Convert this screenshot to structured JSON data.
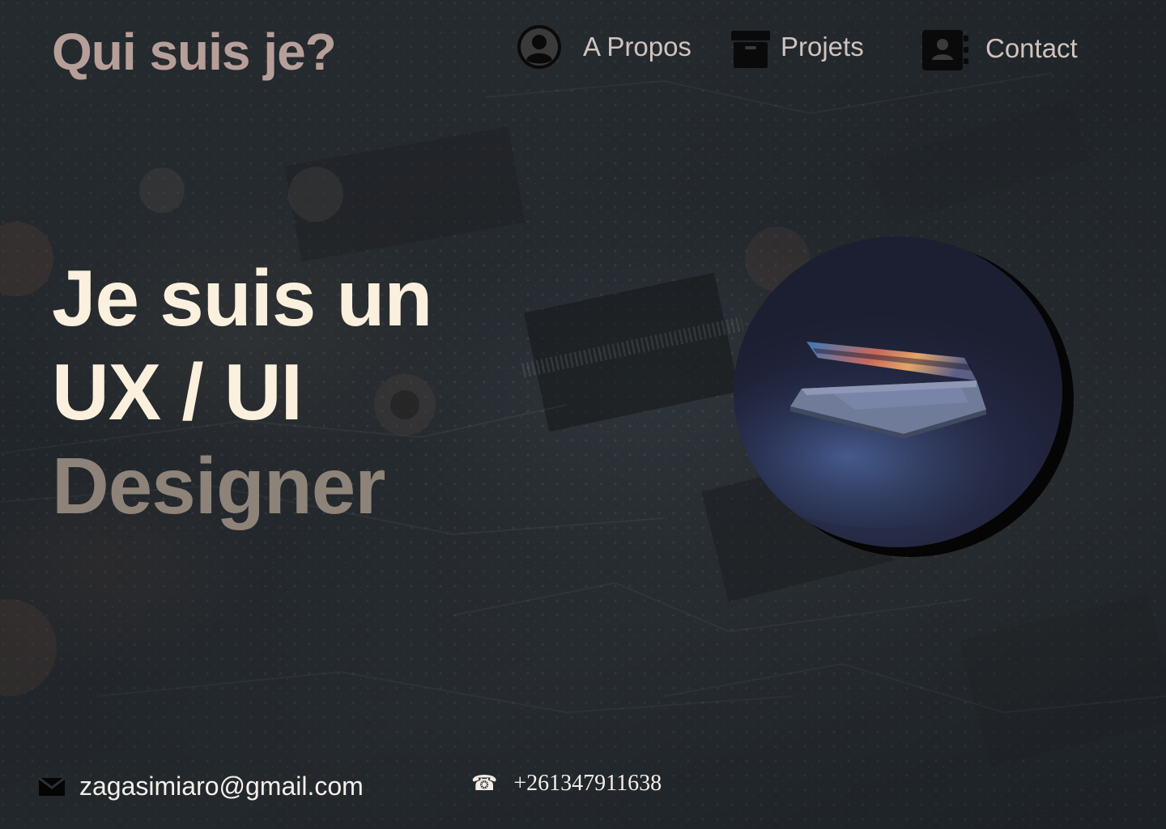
{
  "header": {
    "brand": "Qui suis je?",
    "nav": [
      {
        "label": "A Propos",
        "icon": "user-circle-icon"
      },
      {
        "label": "Projets",
        "icon": "archive-box-icon"
      },
      {
        "label": "Contact",
        "icon": "address-book-icon"
      }
    ]
  },
  "hero": {
    "line1": "Je suis un",
    "line2": "UX / UI",
    "line3": "Designer"
  },
  "photo": {
    "subject": "laptop-photo"
  },
  "footer": {
    "email": "zagasimiaro@gmail.com",
    "phone": "+261347911638",
    "email_icon": "mail-icon",
    "phone_icon": "phone-icon"
  },
  "colors": {
    "brand": "#b79f99",
    "hero_primary": "#fbf0dd",
    "hero_secondary": "#8d8379",
    "nav_text": "#cfc3bd",
    "background": "#262b31"
  }
}
